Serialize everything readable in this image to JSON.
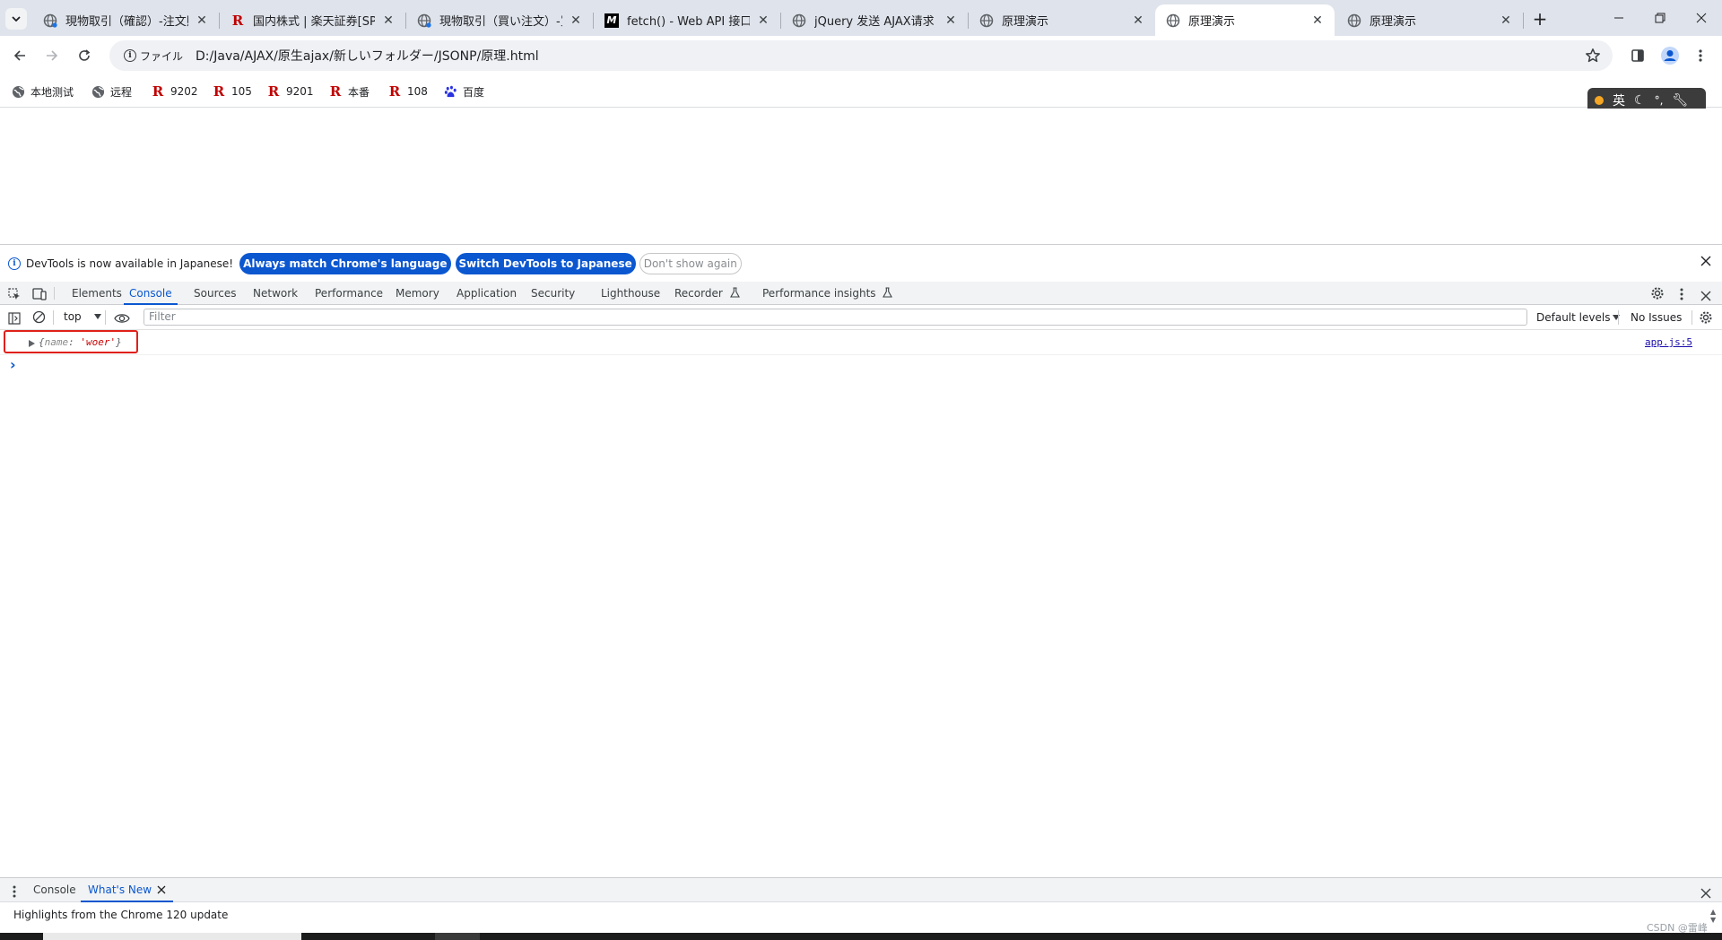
{
  "browser": {
    "tabs": [
      {
        "title": "現物取引（確認）-注文照会",
        "favicon": "globe-icon",
        "active": false
      },
      {
        "title": "国内株式 | 楽天証券[SP]",
        "favicon": "rakuten-icon",
        "active": false
      },
      {
        "title": "現物取引（買い注文）-買",
        "favicon": "globe-icon",
        "active": false
      },
      {
        "title": "fetch() - Web API 接口参考",
        "favicon": "mdn-icon",
        "active": false
      },
      {
        "title": "jQuery 发送 AJAX请求",
        "favicon": "globe-icon",
        "active": false
      },
      {
        "title": "原理演示",
        "favicon": "globe-icon",
        "active": false
      },
      {
        "title": "原理演示",
        "favicon": "globe-icon",
        "active": true
      },
      {
        "title": "原理演示",
        "favicon": "globe-icon",
        "active": false
      }
    ],
    "new_tab": "+",
    "address": {
      "chip": "ファイル",
      "url": "D:/Java/AJAX/原生ajax/新しいフォルダー/JSONP/原理.html"
    },
    "bookmarks": [
      {
        "label": "本地测试",
        "icon": "globe-icon"
      },
      {
        "label": "远程",
        "icon": "globe-icon"
      },
      {
        "label": "9202",
        "icon": "rakuten-icon"
      },
      {
        "label": "105",
        "icon": "rakuten-icon"
      },
      {
        "label": "9201",
        "icon": "rakuten-icon"
      },
      {
        "label": "本番",
        "icon": "rakuten-icon"
      },
      {
        "label": "108",
        "icon": "rakuten-icon"
      },
      {
        "label": "百度",
        "icon": "baidu-icon"
      }
    ],
    "ime": {
      "label": "英"
    },
    "colors": {
      "accent": "#0b57d0",
      "rakuten": "#bf0000",
      "highlight": "#e0201a"
    }
  },
  "devtools": {
    "infobar": {
      "message": "DevTools is now available in Japanese!",
      "btn_match": "Always match Chrome's language",
      "btn_switch": "Switch DevTools to Japanese",
      "btn_dismiss": "Don't show again"
    },
    "tabs": [
      "Elements",
      "Console",
      "Sources",
      "Network",
      "Performance",
      "Memory",
      "Application",
      "Security",
      "Lighthouse",
      "Recorder",
      "Performance insights"
    ],
    "active_tab": "Console",
    "console_toolbar": {
      "context": "top",
      "filter_placeholder": "Filter",
      "levels": "Default levels",
      "issues": "No Issues"
    },
    "log": {
      "brace_open": "{",
      "key": "name",
      "colon": ": ",
      "value": "'woer'",
      "brace_close": "}",
      "source": "app.js:5"
    },
    "prompt": "›",
    "drawer": {
      "tab_console": "Console",
      "tab_whats_new": "What's New",
      "highlight": "Highlights from the Chrome 120 update"
    }
  },
  "watermark": "CSDN @雷峰"
}
